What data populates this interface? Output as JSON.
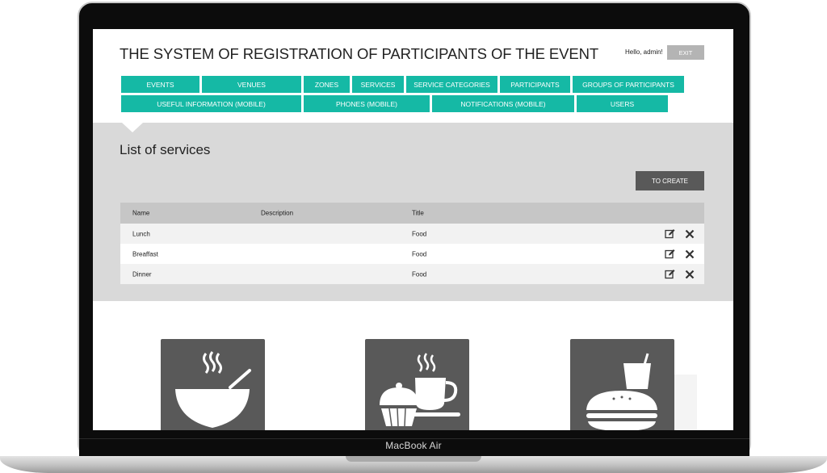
{
  "device": {
    "label": "MacBook Air"
  },
  "header": {
    "title": "THE SYSTEM OF REGISTRATION OF PARTICIPANTS OF THE EVENT",
    "greeting": "Hello, admin!",
    "exit_label": "EXIT"
  },
  "nav": {
    "row1": [
      "EVENTS",
      "VENUES",
      "ZONES",
      "SERVICES",
      "SERVICE CATEGORIES",
      "PARTICIPANTS",
      "GROUPS OF PARTICIPANTS"
    ],
    "row2": [
      "USEFUL INFORMATION (MOBILE)",
      "PHONES (MOBILE)",
      "NOTIFICATIONS (MOBILE)",
      "USERS"
    ]
  },
  "main": {
    "page_title": "List of services",
    "create_label": "TO CREATE"
  },
  "table": {
    "headers": [
      "Name",
      "Description",
      "Title"
    ],
    "rows": [
      {
        "name": "Lunch",
        "description": "",
        "title": "Food"
      },
      {
        "name": "Breaffast",
        "description": "",
        "title": "Food"
      },
      {
        "name": "Dinner",
        "description": "",
        "title": "Food"
      }
    ]
  },
  "tiles": [
    {
      "icon": "soup-bowl-icon"
    },
    {
      "icon": "coffee-cupcake-icon"
    },
    {
      "icon": "burger-drink-icon"
    }
  ],
  "colors": {
    "nav": "#15b9a5",
    "tile": "#595959",
    "panel": "#d9d9d9",
    "create": "#595959"
  }
}
